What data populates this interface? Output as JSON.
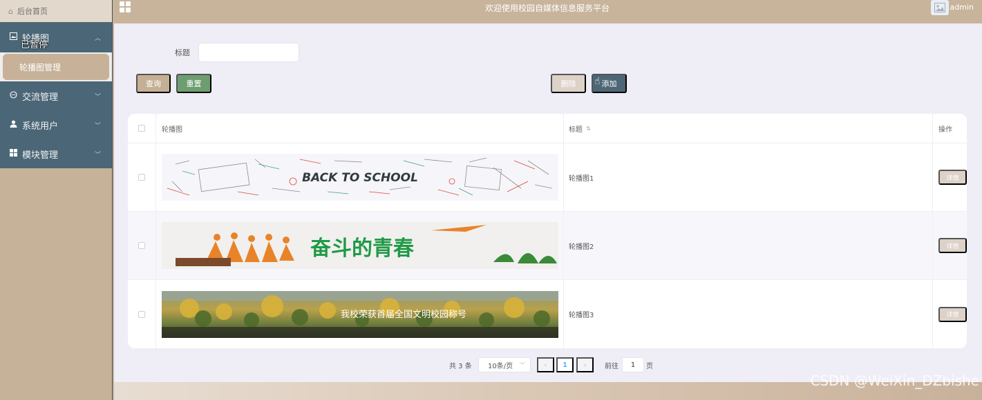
{
  "sidebar": {
    "home": "后台首页",
    "menu": [
      {
        "label": "轮播图",
        "icon": "image-icon",
        "open": true,
        "paused_tag": "已暂停"
      },
      {
        "label": "交流管理",
        "icon": "chat-icon"
      },
      {
        "label": "系统用户",
        "icon": "user-icon"
      },
      {
        "label": "模块管理",
        "icon": "grid-icon"
      }
    ],
    "submenu": [
      "轮播图管理"
    ]
  },
  "topbar": {
    "title": "欢迎使用校园自媒体信息服务平台",
    "user": "admin"
  },
  "search": {
    "label": "标题",
    "value": "",
    "query_button": "查询",
    "reset_button": "重置",
    "delete_button": "删除",
    "add_button": "添加"
  },
  "table": {
    "headers": {
      "image": "轮播图",
      "title": "标题",
      "operation": "操作"
    },
    "rows": [
      {
        "banner_text": "BACK TO SCHOOL",
        "title": "轮播图1",
        "action": "详情"
      },
      {
        "banner_text": "奋斗的青春",
        "title": "轮播图2",
        "action": "详情"
      },
      {
        "banner_text": "我校荣获首届全国文明校园称号",
        "title": "轮播图3",
        "action": "详情"
      }
    ]
  },
  "pagination": {
    "total": "共 3 条",
    "page_size": "10条/页",
    "current_page": "1",
    "goto_label": "前往",
    "goto_value": "1",
    "goto_unit": "页"
  },
  "watermark": "CSDN @WeiXin_DZbishe",
  "colors": {
    "sidebar_menu": "#4b6777",
    "topbar": "#c8b49b",
    "query_button": "#c5b095",
    "reset_button": "#6e9e70",
    "add_button": "#4e6776"
  }
}
